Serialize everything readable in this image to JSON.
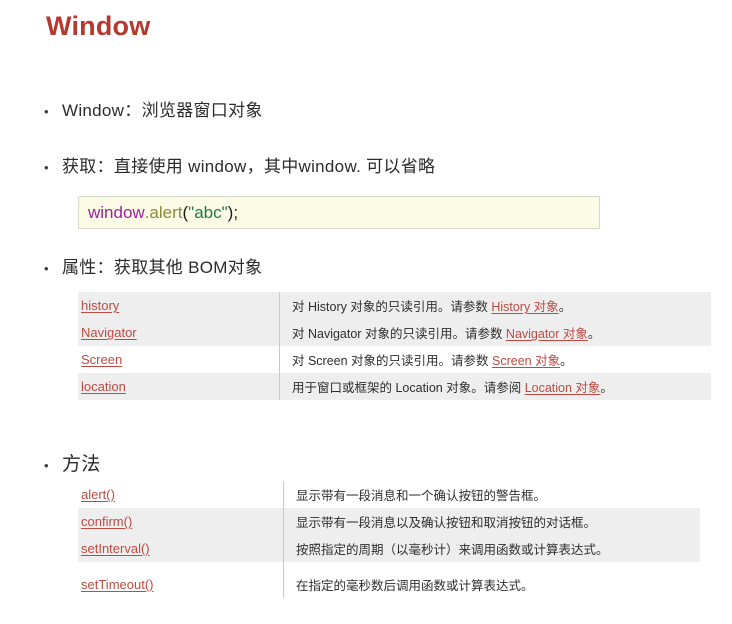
{
  "slide": {
    "title": "Window"
  },
  "bullets": {
    "window_def": {
      "marker": "•",
      "label": "Window：",
      "text": "浏览器窗口对象"
    },
    "get": {
      "marker": "•",
      "label": "获取：",
      "text": "直接使用 window，其中window. 可以省略"
    },
    "properties": {
      "marker": "•",
      "label": "属性：",
      "text": "获取其他 BOM对象"
    },
    "methods": {
      "marker": "•",
      "text": "方法"
    }
  },
  "code_block": {
    "object": "window",
    "dot_method": ".alert",
    "open_paren": "(",
    "string_arg": "\"abc\"",
    "close_paren": ")",
    "semicolon": ";"
  },
  "properties_table": {
    "rows": [
      {
        "name": "history",
        "desc_prefix": "对 History 对象的只读引用。请参数 ",
        "desc_link": "History 对象",
        "desc_suffix": "。",
        "shaded": true
      },
      {
        "name": "Navigator",
        "desc_prefix": "对 Navigator 对象的只读引用。请参数 ",
        "desc_link": "Navigator 对象",
        "desc_suffix": "。",
        "shaded": true
      },
      {
        "name": "Screen",
        "desc_prefix": "对 Screen 对象的只读引用。请参数 ",
        "desc_link": "Screen 对象",
        "desc_suffix": "。",
        "shaded": false
      },
      {
        "name": "location",
        "desc_prefix": "用于窗口或框架的 Location 对象。请参阅 ",
        "desc_link": "Location 对象",
        "desc_suffix": "。",
        "shaded": true
      }
    ]
  },
  "methods_table": {
    "rows": [
      {
        "name": "alert()",
        "desc": "显示带有一段消息和一个确认按钮的警告框。",
        "shaded": false
      },
      {
        "name": "confirm()",
        "desc": "显示带有一段消息以及确认按钮和取消按钮的对话框。",
        "shaded": true
      },
      {
        "name": "setInterval()",
        "desc": "按照指定的周期（以毫秒计）来调用函数或计算表达式。",
        "shaded": true
      },
      {
        "name": "setTimeout()",
        "desc": "在指定的毫秒数后调用函数或计算表达式。",
        "shaded": false
      }
    ]
  }
}
